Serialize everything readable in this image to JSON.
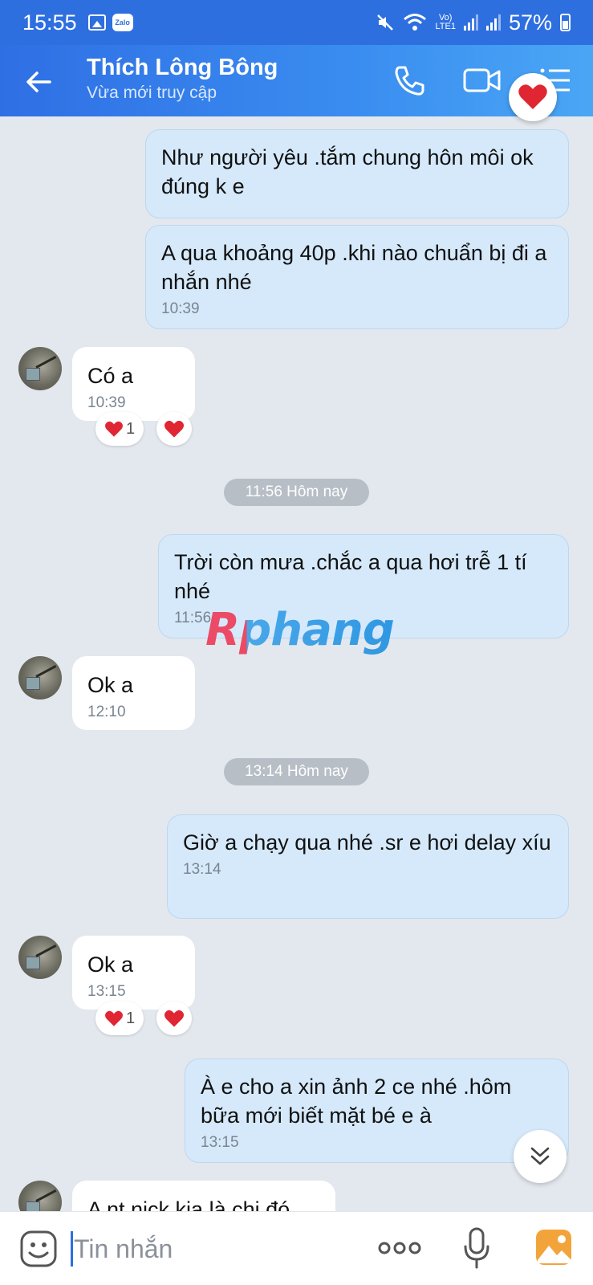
{
  "status_bar": {
    "time": "15:55",
    "zalo_badge": "Zalo",
    "volte": "Vo)",
    "lte": "LTE1",
    "battery": "57%"
  },
  "header": {
    "contact_name": "Thích Lông Bông",
    "contact_status": "Vừa mới truy cập"
  },
  "messages": [
    {
      "side": "sent",
      "text": "Như người yêu .tắm chung hôn môi ok đúng k e",
      "time": ""
    },
    {
      "side": "sent",
      "text": "A qua khoảng 40p .khi nào chuẩn bị đi a nhắn nhé",
      "time": "10:39"
    },
    {
      "side": "received",
      "text": "Có a",
      "time": "10:39",
      "reaction_count": "1"
    },
    {
      "side": "sent",
      "text": "Trời còn mưa .chắc a qua hơi trễ 1 tí nhé",
      "time": "11:56"
    },
    {
      "side": "received",
      "text": "Ok a",
      "time": "12:10"
    },
    {
      "side": "sent",
      "text": "Giờ a chạy qua nhé .sr e hơi delay xíu",
      "time": "13:14"
    },
    {
      "side": "received",
      "text": "Ok a",
      "time": "13:15",
      "reaction_count": "1"
    },
    {
      "side": "sent",
      "text": "À e cho a xin ảnh 2 ce nhé .hôm bữa mới biết mặt bé e à",
      "time": "13:15"
    },
    {
      "side": "received",
      "text": "A nt nick kia là chị đó",
      "time": ""
    }
  ],
  "date_separators": [
    "11:56 Hôm nay",
    "13:14 Hôm nay"
  ],
  "watermark": "Rphang",
  "input": {
    "placeholder": "Tin nhắn"
  },
  "icons": {
    "heart": "❤",
    "more": "ooo"
  },
  "colors": {
    "header_blue": "#2e6fe0",
    "sent_bubble": "#d5e9fb",
    "received_bubble": "#ffffff",
    "chat_background": "#e3e8ee",
    "heart_red": "#e02633"
  }
}
